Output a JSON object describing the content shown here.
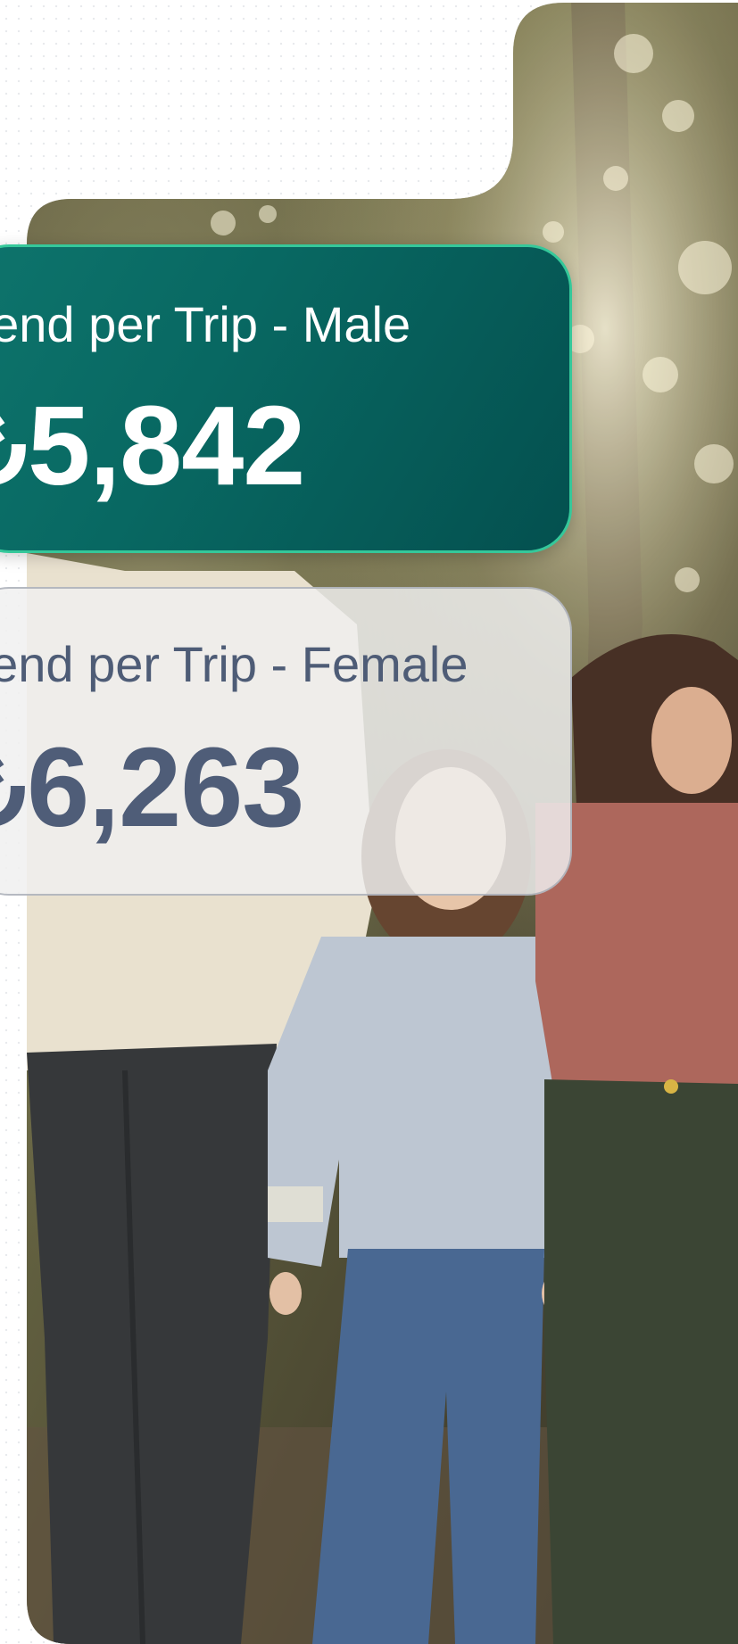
{
  "cards": {
    "male": {
      "label": "pend per Trip - Male",
      "currency": "₺",
      "value": "5,842"
    },
    "female": {
      "label": "pend per Trip - Female",
      "currency": "₺",
      "value": "6,263"
    }
  },
  "colors": {
    "male_card_bg": "#086862",
    "male_card_border": "#35c89a",
    "female_card_text": "#4f5d78",
    "female_card_bg": "#f0f0f0"
  }
}
